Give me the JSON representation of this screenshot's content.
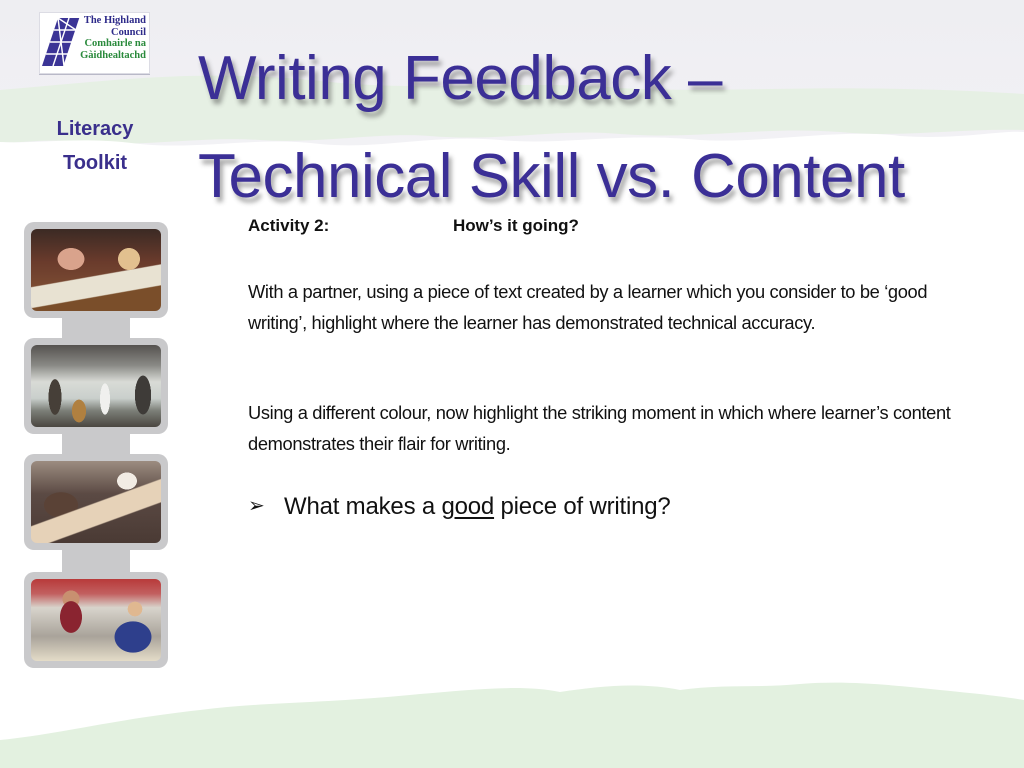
{
  "logo": {
    "lines": [
      "The Highland",
      "Council",
      "Comhairle na",
      "Gàidhealtachd"
    ],
    "colors": {
      "primary": "#2e2b8a",
      "secondary": "#2a8a3c"
    }
  },
  "sidebar": {
    "toolkit_line1": "Literacy",
    "toolkit_line2": "Toolkit",
    "photos": [
      {
        "name": "pupils-reading-newspapers"
      },
      {
        "name": "musicians-outdoors"
      },
      {
        "name": "classroom-group-work"
      },
      {
        "name": "teacher-helping-pupil"
      }
    ]
  },
  "title": {
    "line1": "Writing Feedback –",
    "line2": "Technical Skill vs. Content",
    "color": "#3b2f96"
  },
  "content": {
    "activity_label": "Activity 2:",
    "activity_question": "How’s it going?",
    "paragraph1": "With a partner, using a piece of text created by a learner which you consider to be ‘good writing’, highlight where the learner has demonstrated technical accuracy.",
    "paragraph2": "Using a different colour, now highlight the striking moment in which where learner’s content demonstrates their flair for writing.",
    "bullet": {
      "icon": "arrow-bullet-icon",
      "before": "What makes a ",
      "underlined": "good",
      "after": " piece of writing?"
    }
  }
}
